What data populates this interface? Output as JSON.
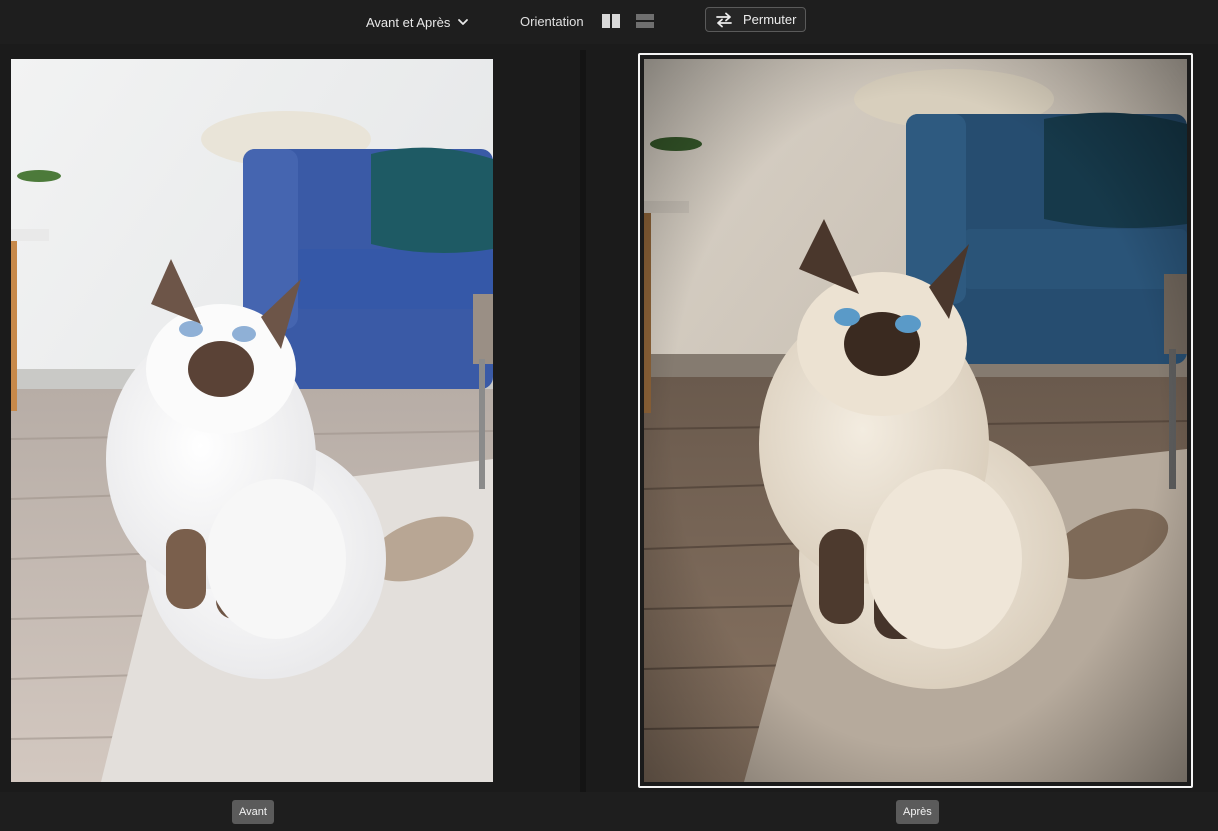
{
  "toolbar": {
    "view_mode_label": "Avant et Après",
    "orientation_label": "Orientation",
    "swap_label": "Permuter",
    "icons": {
      "view_mode": "chevron-down-icon",
      "side_by_side": "side-by-side-layout-icon",
      "stacked": "top-bottom-layout-icon",
      "swap": "swap-arrows-icon"
    }
  },
  "panes": {
    "before": {
      "label": "Avant"
    },
    "after": {
      "label": "Après",
      "selected": true
    }
  },
  "colors": {
    "background": "#1b1b1b",
    "toolbar": "#1e1e1e",
    "selection_outline": "#f4f4f4",
    "label_pill": "#5b5b5b"
  }
}
